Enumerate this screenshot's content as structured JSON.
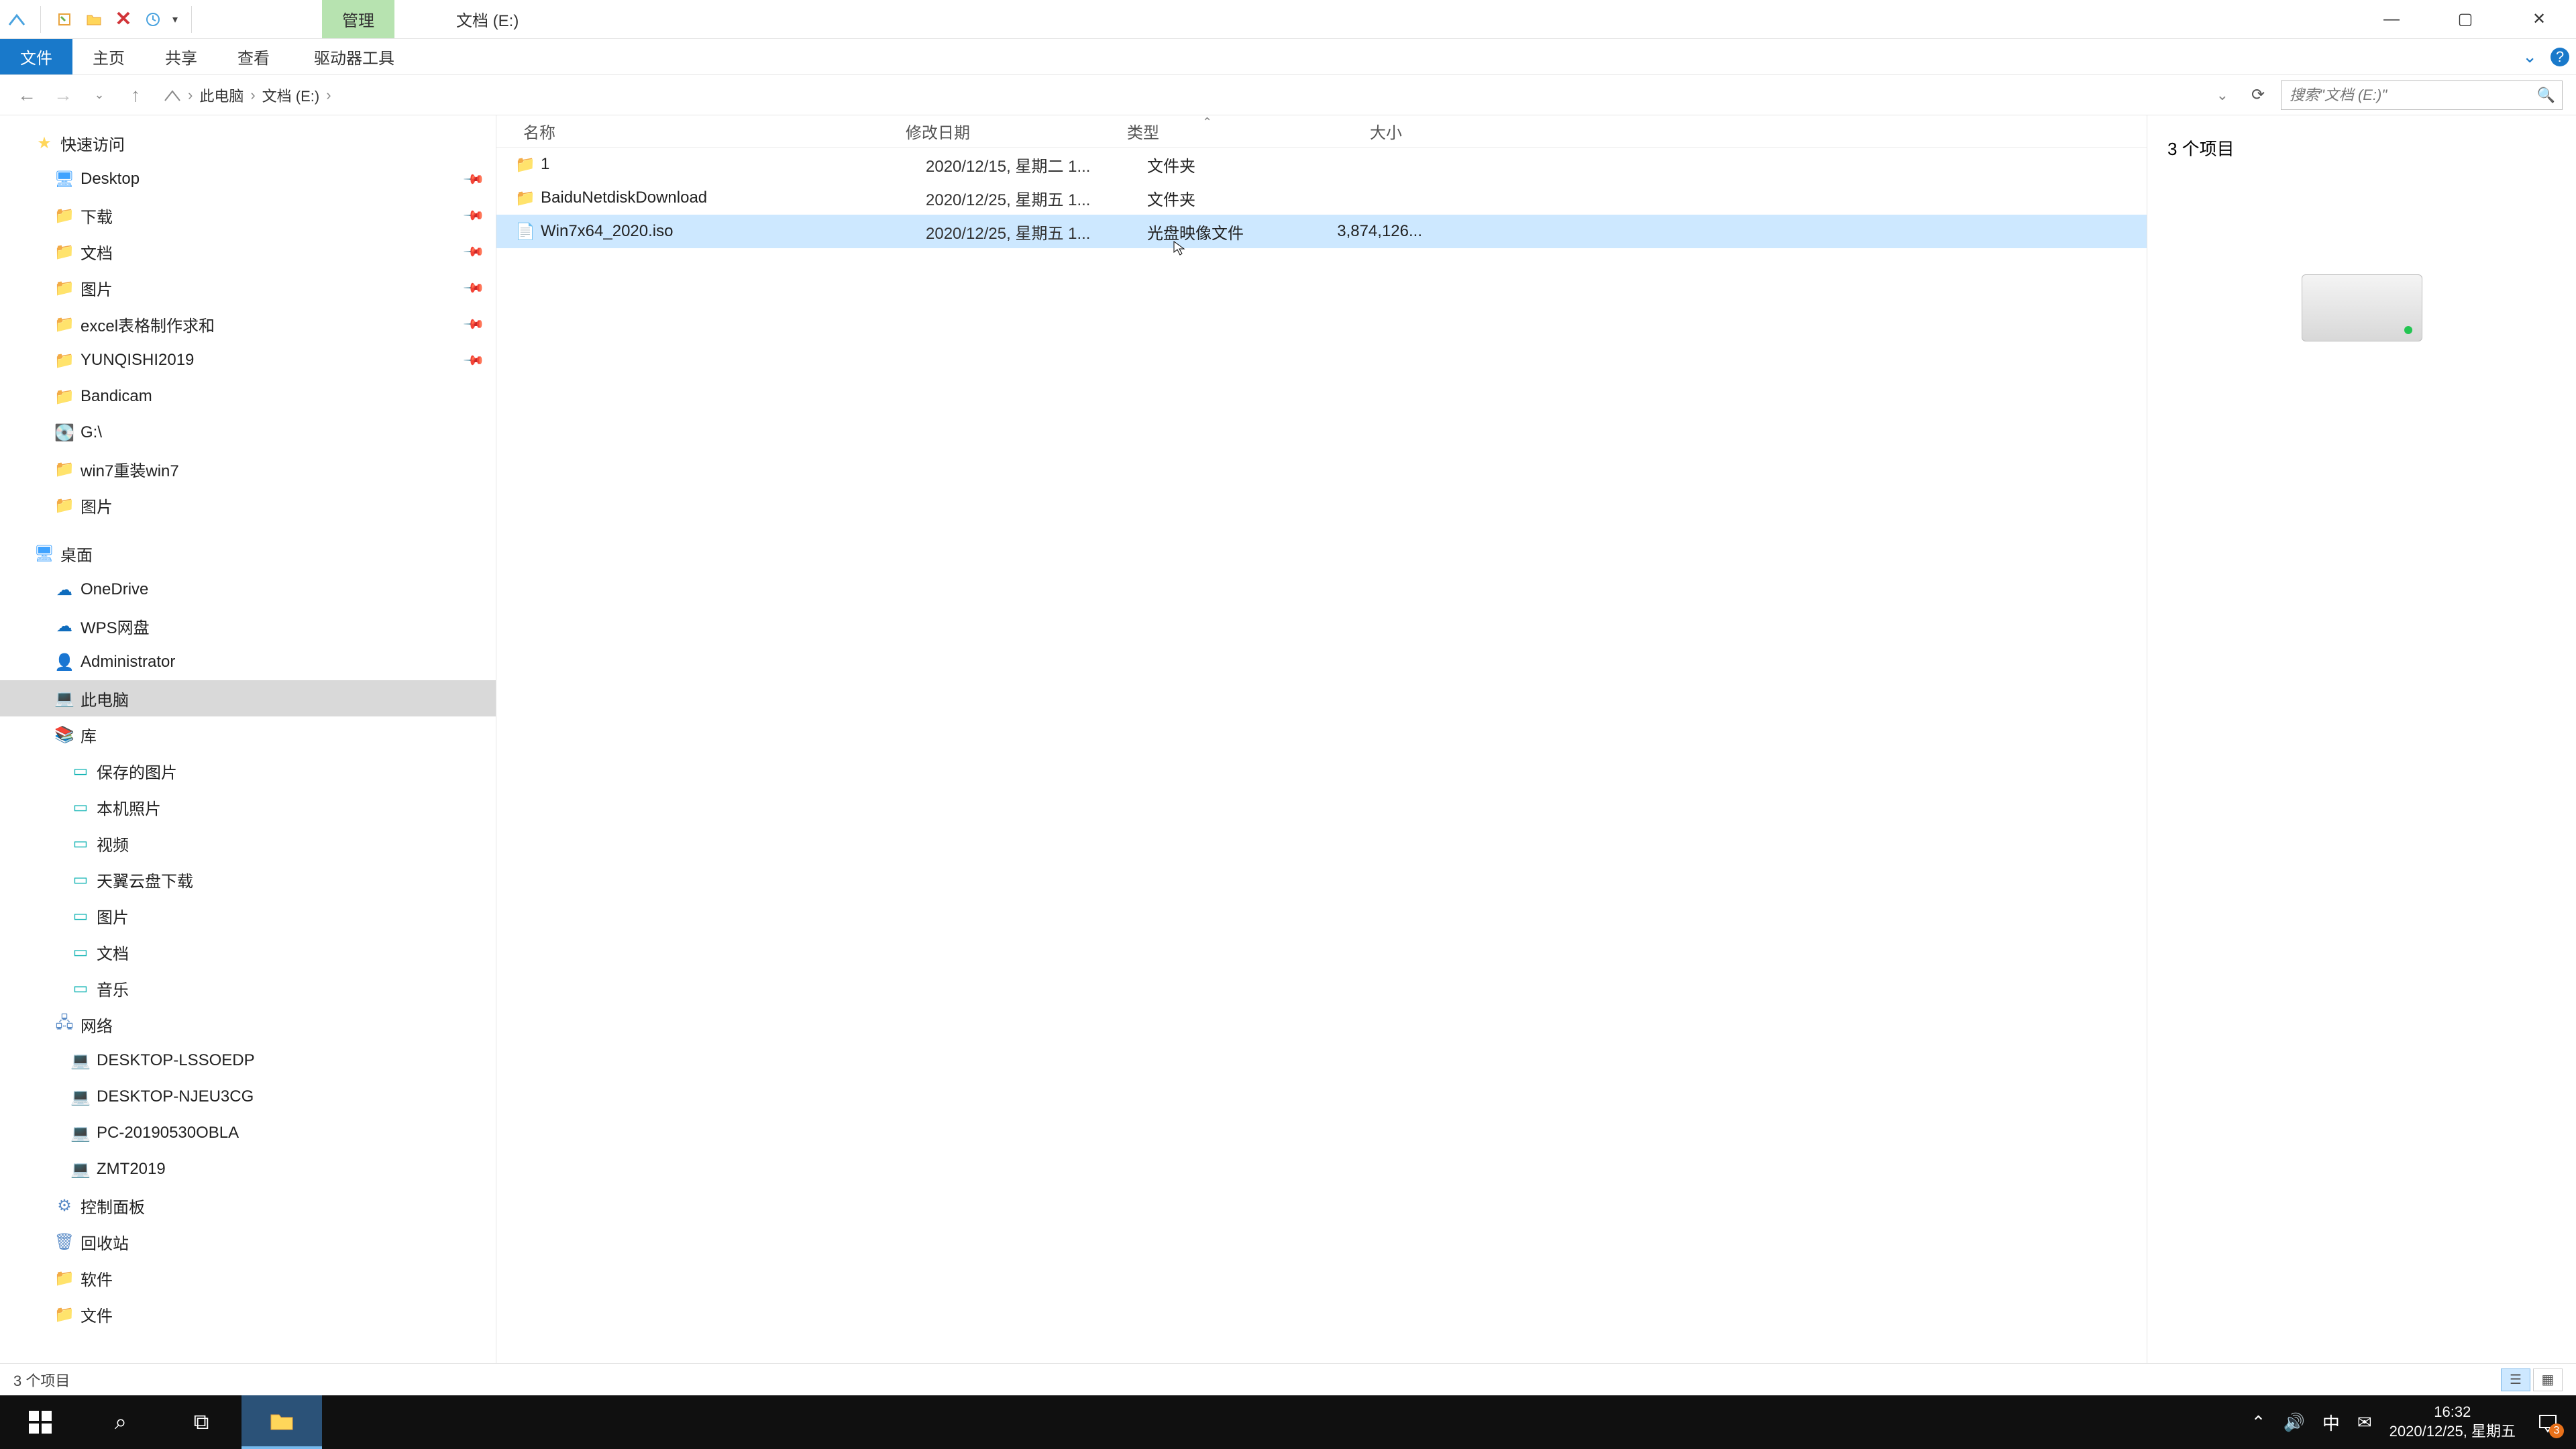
{
  "titlebar": {
    "contextual_tab": "管理",
    "window_title": "文档 (E:)"
  },
  "ribbon": {
    "file": "文件",
    "home": "主页",
    "share": "共享",
    "view": "查看",
    "drive_tools": "驱动器工具"
  },
  "address": {
    "crumbs": [
      "此电脑",
      "文档 (E:)"
    ],
    "search_placeholder": "搜索\"文档 (E:)\""
  },
  "sidebar": {
    "quick_access": "快速访问",
    "quick": [
      {
        "label": "Desktop",
        "icon": "desktop",
        "pinned": true
      },
      {
        "label": "下载",
        "icon": "folder",
        "pinned": true
      },
      {
        "label": "文档",
        "icon": "folder",
        "pinned": true
      },
      {
        "label": "图片",
        "icon": "folder",
        "pinned": true
      },
      {
        "label": "excel表格制作求和",
        "icon": "folder",
        "pinned": true
      },
      {
        "label": "YUNQISHI2019",
        "icon": "folder",
        "pinned": true
      },
      {
        "label": "Bandicam",
        "icon": "folder"
      },
      {
        "label": "G:\\",
        "icon": "disk"
      },
      {
        "label": "win7重装win7",
        "icon": "folder"
      },
      {
        "label": "图片",
        "icon": "folder"
      }
    ],
    "desktop_root": "桌面",
    "desktop": [
      {
        "label": "OneDrive",
        "icon": "cloud"
      },
      {
        "label": "WPS网盘",
        "icon": "wps"
      },
      {
        "label": "Administrator",
        "icon": "user"
      },
      {
        "label": "此电脑",
        "icon": "pc",
        "selected": true
      },
      {
        "label": "库",
        "icon": "lib"
      }
    ],
    "libraries": [
      {
        "label": "保存的图片",
        "icon": "teal"
      },
      {
        "label": "本机照片",
        "icon": "teal"
      },
      {
        "label": "视频",
        "icon": "teal"
      },
      {
        "label": "天翼云盘下载",
        "icon": "teal"
      },
      {
        "label": "图片",
        "icon": "teal"
      },
      {
        "label": "文档",
        "icon": "teal"
      },
      {
        "label": "音乐",
        "icon": "teal"
      }
    ],
    "network_root": "网络",
    "network": [
      {
        "label": "DESKTOP-LSSOEDP",
        "icon": "pc"
      },
      {
        "label": "DESKTOP-NJEU3CG",
        "icon": "pc"
      },
      {
        "label": "PC-20190530OBLA",
        "icon": "pc"
      },
      {
        "label": "ZMT2019",
        "icon": "pc"
      }
    ],
    "tail": [
      {
        "label": "控制面板",
        "icon": "panel"
      },
      {
        "label": "回收站",
        "icon": "bin"
      },
      {
        "label": "软件",
        "icon": "folder"
      },
      {
        "label": "文件",
        "icon": "folder"
      }
    ]
  },
  "columns": {
    "name": "名称",
    "date": "修改日期",
    "type": "类型",
    "size": "大小"
  },
  "files": [
    {
      "name": "1",
      "date": "2020/12/15, 星期二 1...",
      "type": "文件夹",
      "size": "",
      "kind": "folder"
    },
    {
      "name": "BaiduNetdiskDownload",
      "date": "2020/12/25, 星期五 1...",
      "type": "文件夹",
      "size": "",
      "kind": "folder"
    },
    {
      "name": "Win7x64_2020.iso",
      "date": "2020/12/25, 星期五 1...",
      "type": "光盘映像文件",
      "size": "3,874,126...",
      "kind": "file",
      "selected": true
    }
  ],
  "details": {
    "summary": "3 个项目"
  },
  "status": {
    "text": "3 个项目"
  },
  "taskbar": {
    "time": "16:32",
    "date": "2020/12/25, 星期五",
    "ime": "中",
    "notif_count": "3"
  }
}
